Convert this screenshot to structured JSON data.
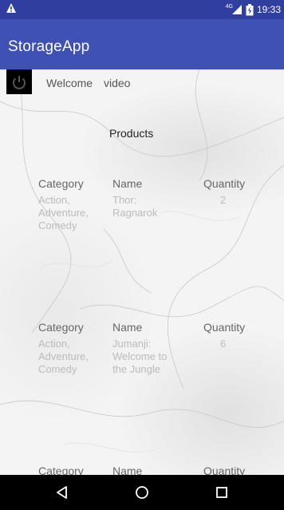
{
  "status_bar": {
    "network_label": "4G",
    "time": "19:33",
    "left_icon": "alert-triangle-icon",
    "right_icons": [
      "signal-icon",
      "battery-charging-icon"
    ]
  },
  "app_bar": {
    "title": "StorageApp",
    "color": "#3f51b5",
    "status_color": "#303f9f"
  },
  "welcome": {
    "label": "Welcome",
    "username": "video",
    "power_icon": "power-icon"
  },
  "products": {
    "title": "Products",
    "header": {
      "category": "Category",
      "name": "Name",
      "quantity": "Quantity"
    },
    "items": [
      {
        "category": "Action,\nAdventure,\nComedy",
        "name": "Thor:\nRagnarok",
        "quantity": "2"
      },
      {
        "category": "Action,\nAdventure,\nComedy",
        "name": "Jumanji:\nWelcome to\nthe Jungle",
        "quantity": "6"
      },
      {
        "category": "",
        "name": "",
        "quantity": ""
      }
    ]
  },
  "nav_bar": {
    "icons": [
      "back-icon",
      "home-icon",
      "recents-icon"
    ]
  }
}
